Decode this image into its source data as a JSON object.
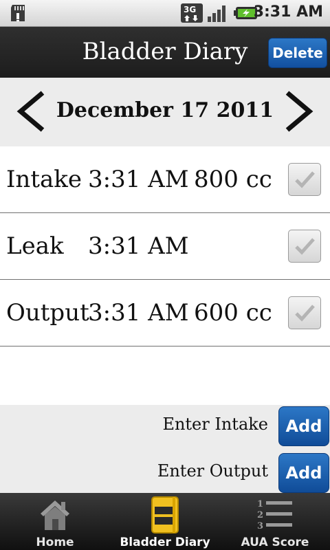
{
  "status_bar": {
    "network": "3G",
    "time": "3:31 AM"
  },
  "header": {
    "title": "Bladder Diary",
    "delete_label": "Delete"
  },
  "date_nav": {
    "date": "December 17 2011",
    "prev_icon": "chevron-left-icon",
    "next_icon": "chevron-right-icon"
  },
  "entries": [
    {
      "type": "Intake",
      "time": "3:31 AM",
      "amount": "800 cc",
      "checked": true
    },
    {
      "type": "Leak",
      "time": "3:31 AM",
      "amount": "",
      "checked": true
    },
    {
      "type": "Output",
      "time": "3:31 AM",
      "amount": "600 cc",
      "checked": true
    }
  ],
  "add_panel": {
    "intake_label": "Enter Intake",
    "output_label": "Enter Output",
    "add_label": "Add"
  },
  "tabs": [
    {
      "label": "Home",
      "icon": "house-icon",
      "active": false
    },
    {
      "label": "Bladder Diary",
      "icon": "diary-icon",
      "active": true
    },
    {
      "label": "AUA Score",
      "icon": "numbered-list-icon",
      "active": false
    }
  ],
  "colors": {
    "accent": "#1a5fb0",
    "header_bg": "#262626",
    "active_tab_icon": "#f0c020"
  }
}
